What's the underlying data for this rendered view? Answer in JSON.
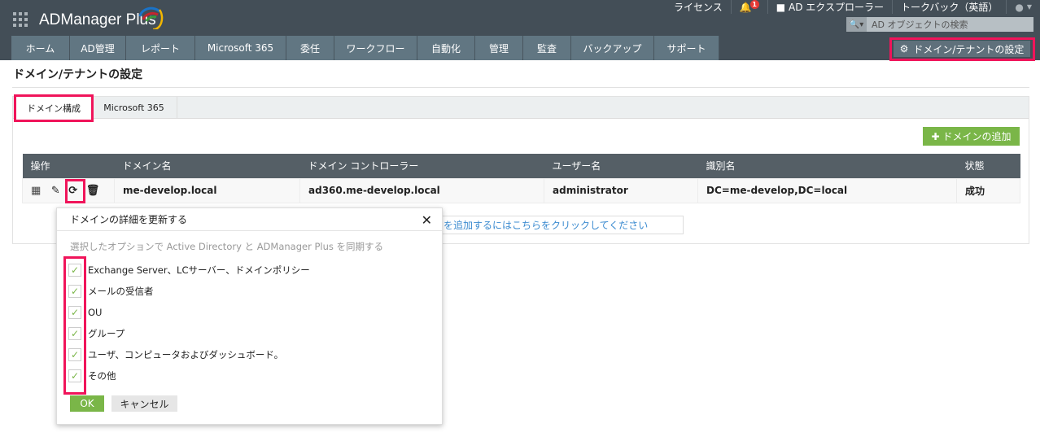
{
  "app": {
    "logo": "ADManager Plus"
  },
  "header": {
    "license": "ライセンス",
    "notif_count": "1",
    "ad_explorer": "AD エクスプローラー",
    "talkback": "トークバック（英語）",
    "search_placeholder": "AD オブジェクトの検索"
  },
  "nav": [
    "ホーム",
    "AD管理",
    "レポート",
    "Microsoft 365",
    "委任",
    "ワークフロー",
    "自動化",
    "管理",
    "監査",
    "バックアップ",
    "サポート"
  ],
  "settings_button": "ドメイン/テナントの設定",
  "page_title": "ドメイン/テナントの設定",
  "tabs": [
    "ドメイン構成",
    "Microsoft 365"
  ],
  "add_domain": "ドメインの追加",
  "table": {
    "headers": [
      "操作",
      "ドメイン名",
      "ドメイン コントローラー",
      "ユーザー名",
      "識別名",
      "状態"
    ],
    "rows": [
      [
        "",
        "me-develop.local",
        "ad360.me-develop.local",
        "administrator",
        "DC=me-develop,DC=local",
        "成功"
      ]
    ]
  },
  "add_link": "を追加するにはこちらをクリックしてください",
  "popup": {
    "title": "ドメインの詳細を更新する",
    "description": "選択したオプションで Active Directory と ADManager Plus を同期する",
    "options": [
      "Exchange Server、LCサーバー、ドメインポリシー",
      "メールの受信者",
      "OU",
      "グループ",
      "ユーザ、コンピュータおよびダッシュボード。",
      "その他"
    ],
    "ok": "OK",
    "cancel": "キャンセル"
  },
  "colors": {
    "accent": "#7ab648",
    "highlight": "#f0145a",
    "header": "#434e57"
  }
}
